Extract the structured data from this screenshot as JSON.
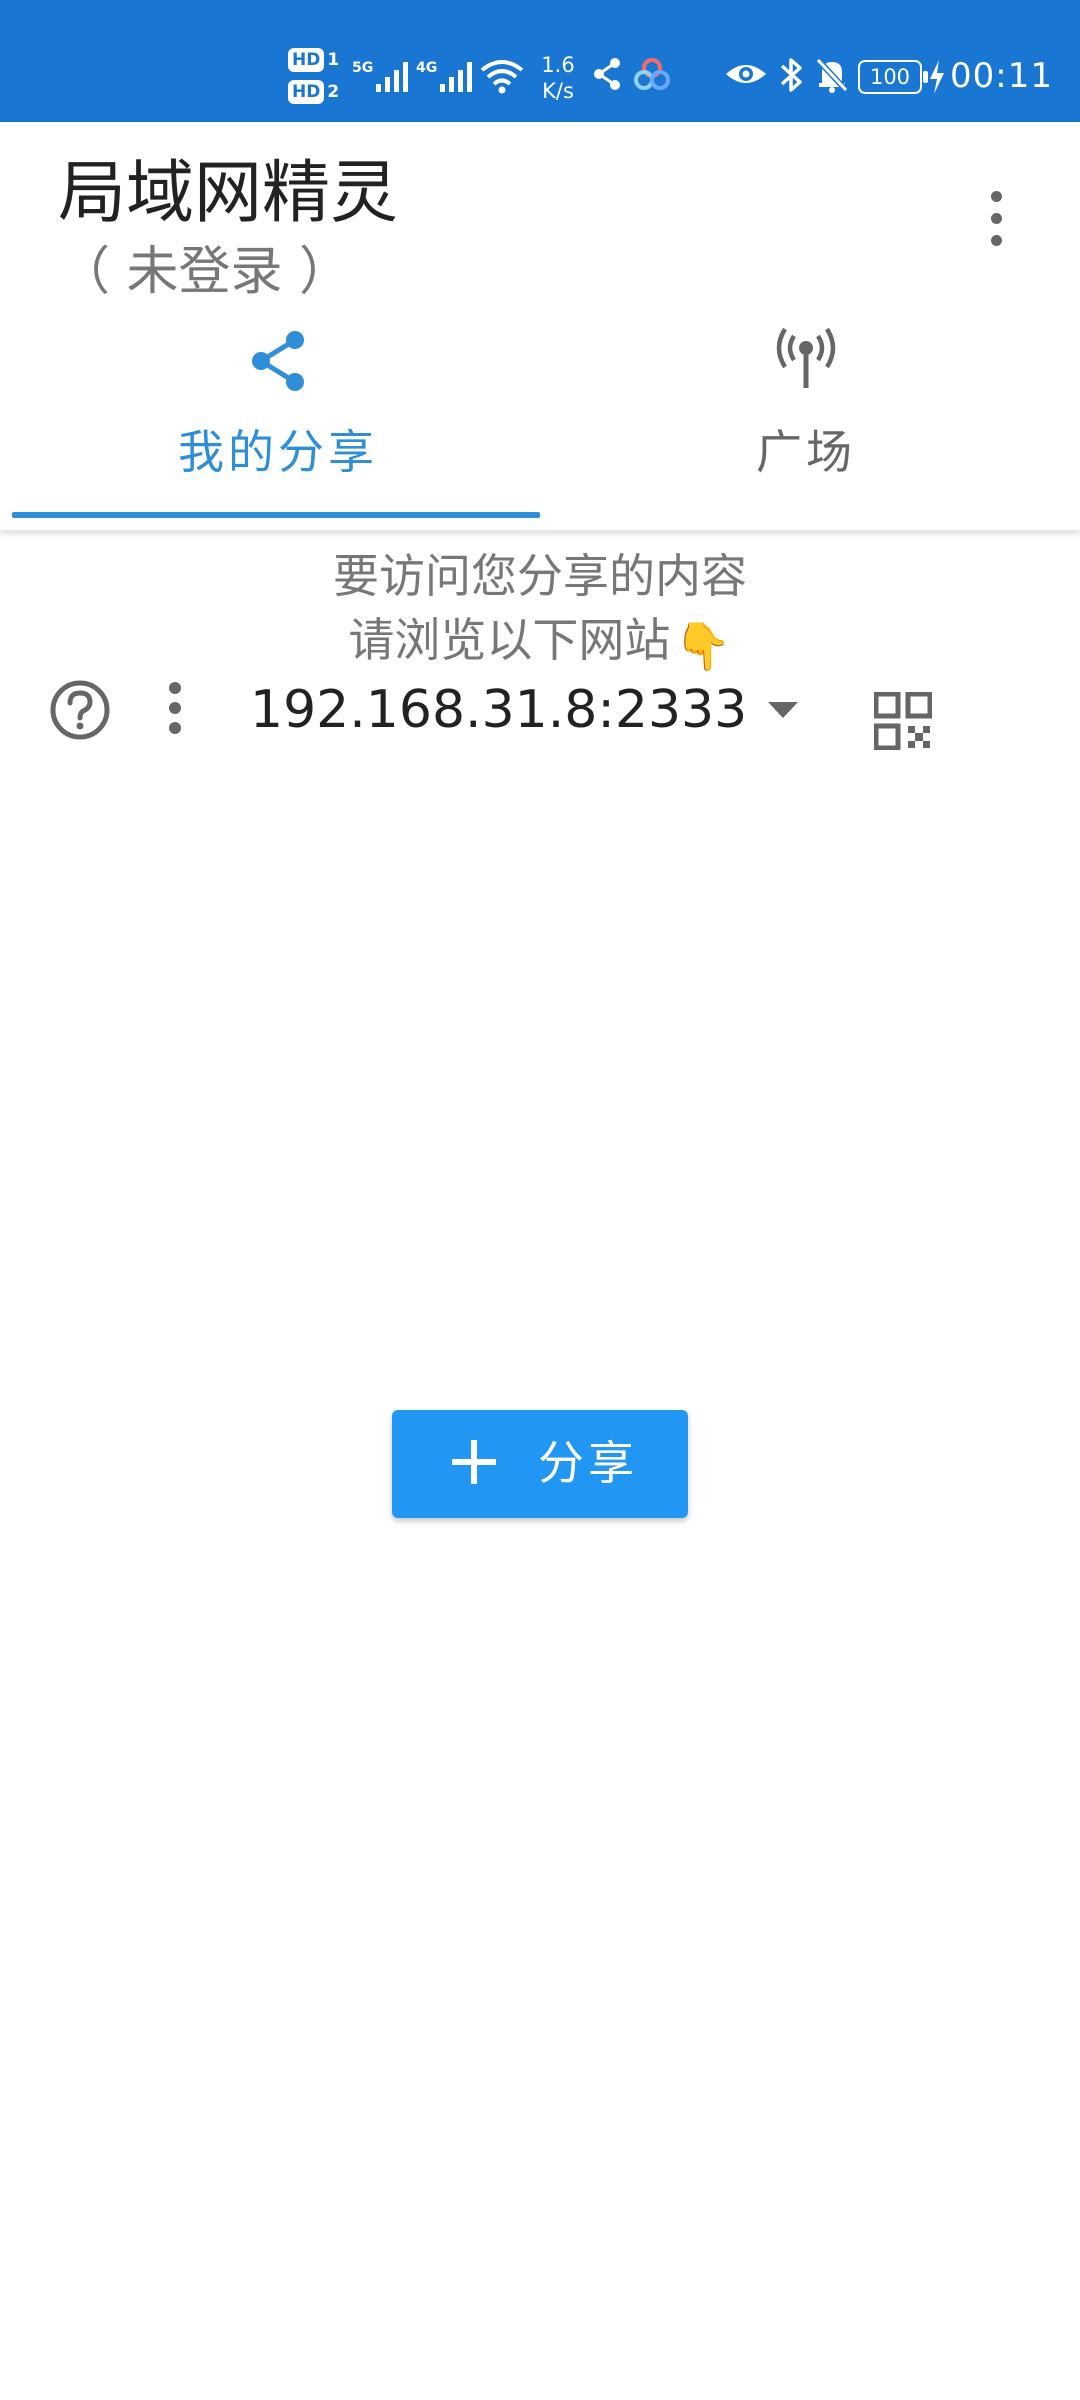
{
  "status_bar": {
    "hd1": "HD",
    "hd1_num": "1",
    "hd2": "HD",
    "hd2_num": "2",
    "sim1_network": "5G",
    "sim2_network": "4G",
    "speed_value": "1.6",
    "speed_unit": "K/s",
    "battery": "100",
    "time": "00:11",
    "color": "#1976d2"
  },
  "header": {
    "title": "局域网精灵",
    "subtitle": "（ 未登录 ）"
  },
  "tabs": [
    {
      "label": "我的分享",
      "icon": "share-icon",
      "active": true
    },
    {
      "label": "广场",
      "icon": "antenna-icon",
      "active": false
    }
  ],
  "content": {
    "hint_line1": "要访问您分享的内容",
    "hint_line2": "请浏览以下网站",
    "pointer_emoji": "👇",
    "address": "192.168.31.8:2333"
  },
  "share_button": {
    "label": "分享",
    "color": "#2196f3"
  },
  "accent_color": "#2f8ed8"
}
